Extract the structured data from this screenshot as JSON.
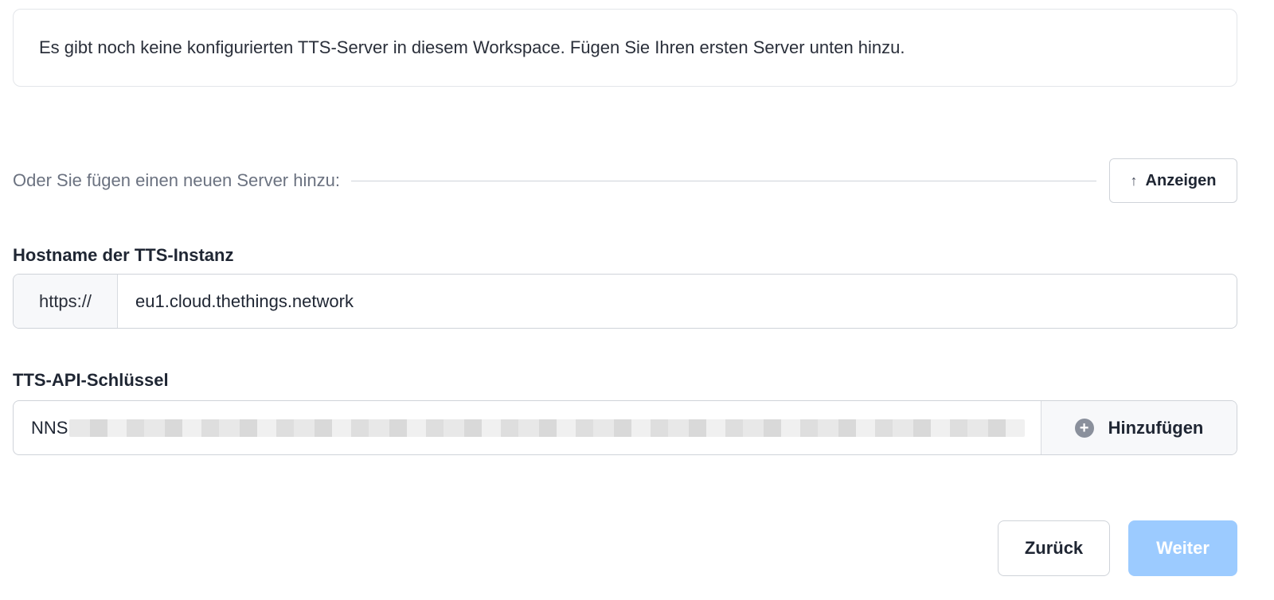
{
  "notice": {
    "text": "Es gibt noch keine konfigurierten TTS-Server in diesem Workspace. Fügen Sie Ihren ersten Server unten hinzu."
  },
  "add_server": {
    "divider_label": "Oder Sie fügen einen neuen Server hinzu:",
    "show_button_icon": "arrow-up-icon",
    "show_button_label": "Anzeigen"
  },
  "hostname": {
    "label": "Hostname der TTS-Instanz",
    "prefix": "https://",
    "value": "eu1.cloud.thethings.network"
  },
  "api_key": {
    "label": "TTS-API-Schlüssel",
    "visible_value": "NNS",
    "add_button_icon": "plus-circle-icon",
    "add_button_label": "Hinzufügen"
  },
  "footer": {
    "back_label": "Zurück",
    "next_label": "Weiter",
    "next_disabled": true
  },
  "colors": {
    "primary_disabled": "#9ccbff",
    "border": "#cfd3d9",
    "text": "#1f2633",
    "muted_text": "#6b7280"
  }
}
